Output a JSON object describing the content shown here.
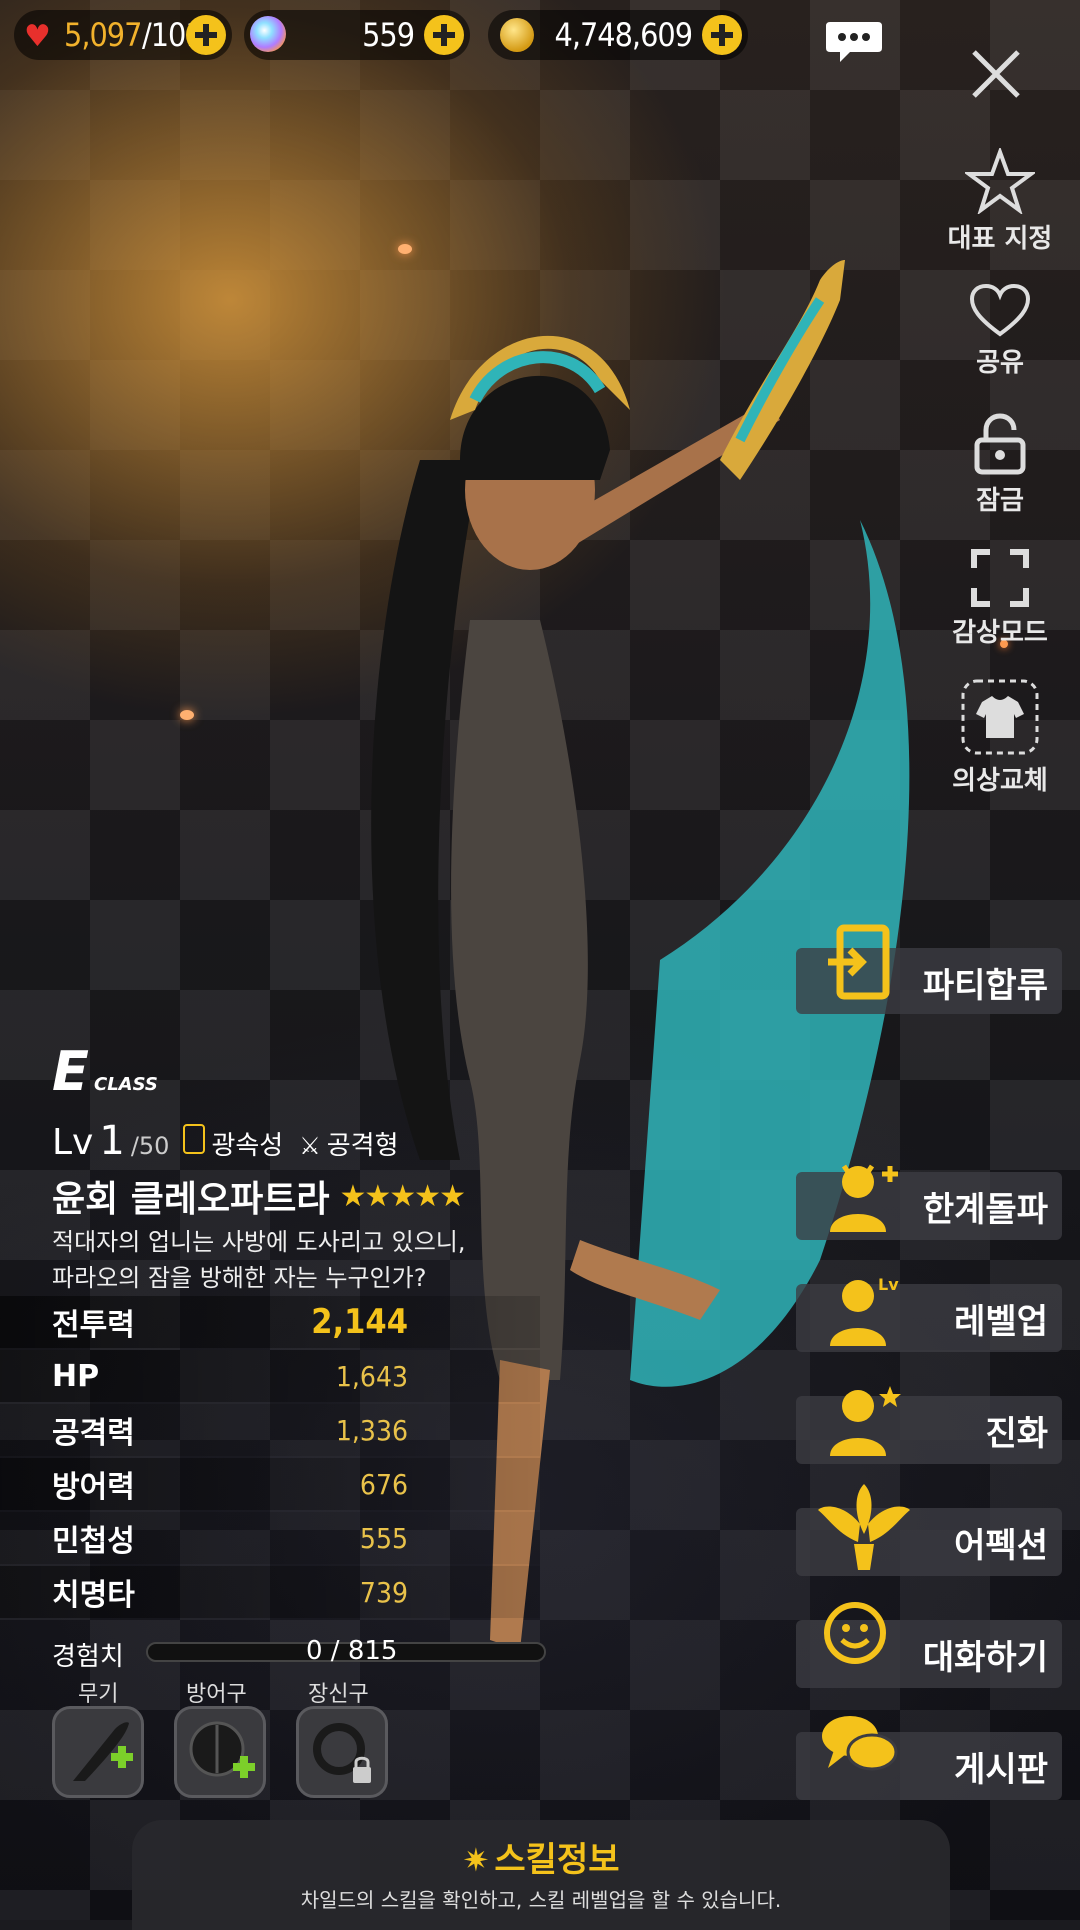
{
  "resources": {
    "hearts": "5,097",
    "hearts_max": "/101",
    "gems": "559",
    "gold": "4,748,609"
  },
  "side_menu": {
    "representative": "대표 지정",
    "share": "공유",
    "lock": "잠금",
    "view_mode": "감상모드",
    "costume": "의상교체"
  },
  "actions": {
    "party_join": "파티합류",
    "limit_break": "한계돌파",
    "level_up": "레벨업",
    "evolve": "진화",
    "affection": "어펙션",
    "talk": "대화하기",
    "board": "게시판"
  },
  "character": {
    "class_letter": "E",
    "class_word": "CLASS",
    "level_prefix": "Lv",
    "level": "1",
    "level_max": "/50",
    "attribute": "광속성",
    "type": "공격형",
    "name": "윤회 클레오파트라",
    "stars": 5,
    "quote_line1": "적대자의 업니는 사방에 도사리고 있으니,",
    "quote_line2": "파라오의 잠을 방해한 자는 누구인가?"
  },
  "stats": {
    "power_label": "전투력",
    "power": "2,144",
    "rows": [
      {
        "label": "HP",
        "value": "1,643"
      },
      {
        "label": "공격력",
        "value": "1,336"
      },
      {
        "label": "방어력",
        "value": "676"
      },
      {
        "label": "민첩성",
        "value": "555"
      },
      {
        "label": "치명타",
        "value": "739"
      }
    ]
  },
  "exp": {
    "label": "경험치",
    "value": "0 / 815",
    "fraction": 0
  },
  "equipment": {
    "weapon": "무기",
    "armor": "방어구",
    "accessory": "장신구"
  },
  "skill": {
    "title": "스킬정보",
    "desc": "차일드의 스킬을 확인하고, 스킬 레벨업을 할 수 있습니다."
  },
  "colors": {
    "accent": "#f4c21b",
    "stat_value": "#e9c24a",
    "panel": "#3c3c42"
  }
}
